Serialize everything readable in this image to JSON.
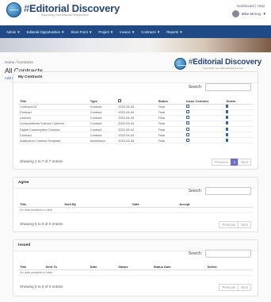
{
  "header": {
    "brand_prefix": "#",
    "brand_name": "Editorial Discovery",
    "tagline": "Supporting Your Editorial Requirement",
    "links": "Dashboard | Help",
    "user_name": "Mike McCoy"
  },
  "nav": [
    "Admin",
    "Editorial Opportunities",
    "Store Front",
    "Project",
    "Invoice",
    "Contracts",
    "Reports"
  ],
  "page": {
    "breadcrumb": "Home / Contracts",
    "title": "All Contracts",
    "add_link": "Add New Contract"
  },
  "my_contracts": {
    "title": "My Contracts",
    "search_label": "Search:",
    "columns": [
      "Title",
      "Type",
      "",
      "Status",
      "Issue Contract",
      "Delete"
    ],
    "rows": [
      [
        "Contract123",
        "Contract",
        "2022-05-05",
        "Final"
      ],
      [
        "Contract",
        "Contract",
        "2022-05-05",
        "Final"
      ],
      [
        "contract",
        "Contract",
        "2022-05-05",
        "Final"
      ],
      [
        "Computational Science Contract",
        "Contract",
        "2022-05-03",
        "Final"
      ],
      [
        "Digital Consumption Contract",
        "Contract",
        "2022-05-02",
        "Final"
      ],
      [
        "Contract",
        "Contract",
        "2022-04-03",
        "Final"
      ],
      [
        "Addendum Contract Template",
        "Addendum",
        "2022-03-28",
        "Final"
      ]
    ],
    "showing": "Showing 1 to 7 of 7 entries",
    "prev": "Previous",
    "page": "1",
    "next": "Next"
  },
  "agree": {
    "title": "Agree",
    "search_label": "Search:",
    "columns": [
      "Title",
      "Sent By",
      "Date",
      "Accept"
    ],
    "empty": "No data available in table",
    "showing": "Showing 0 to 0 of 0 entries",
    "prev": "Previous",
    "next": "Next"
  },
  "issued": {
    "title": "Issued",
    "search_label": "Search:",
    "columns": [
      "Title",
      "Sent To",
      "Date",
      "Status",
      "Status Date",
      "Delete"
    ],
    "empty": "No data available in table",
    "showing": "Showing 0 to 0 of 0 entries",
    "prev": "Previous",
    "next": "Next"
  },
  "colors": {
    "nav_bg": "#204a86",
    "link": "#2a64b4",
    "page_active": "#6d6ec7"
  }
}
